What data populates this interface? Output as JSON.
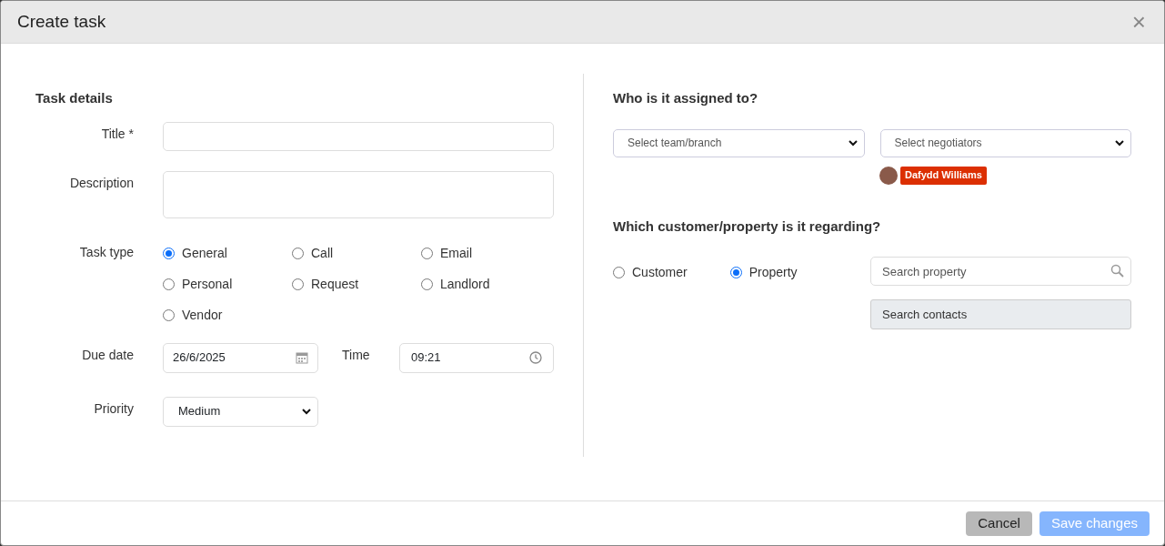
{
  "dialog": {
    "title": "Create task",
    "close": "×"
  },
  "task_details": {
    "heading": "Task details",
    "title_field": {
      "label": "Title *"
    },
    "description_field": {
      "label": "Description"
    },
    "task_type": {
      "label": "Task type",
      "options": [
        {
          "label": "General",
          "selected": true
        },
        {
          "label": "Call",
          "selected": false
        },
        {
          "label": "Email",
          "selected": false
        },
        {
          "label": "Personal",
          "selected": false
        },
        {
          "label": "Request",
          "selected": false
        },
        {
          "label": "Landlord",
          "selected": false
        },
        {
          "label": "Vendor",
          "selected": false
        }
      ]
    },
    "due_date": {
      "label": "Due date",
      "value": "26/6/2025"
    },
    "time": {
      "label": "Time",
      "value": "09:21"
    },
    "priority": {
      "label": "Priority",
      "value": "Medium"
    }
  },
  "assignment": {
    "heading": "Who is it assigned to?",
    "team_select": "Select team/branch",
    "negotiator_select": "Select negotiators",
    "negotiators": [
      {
        "name": "Dafydd Williams",
        "color": "#dc2f02"
      }
    ]
  },
  "regarding": {
    "heading": "Which customer/property is it regarding?",
    "options": [
      {
        "label": "Customer",
        "selected": false
      },
      {
        "label": "Property",
        "selected": true
      }
    ],
    "search": {
      "placeholder": "Search property"
    },
    "contacts_button": "Search contacts"
  },
  "footer": {
    "buttons": [
      {
        "label": "Cancel",
        "kind": "secondary",
        "disabled": false
      },
      {
        "label": "Save changes",
        "kind": "primary",
        "disabled": true
      }
    ]
  }
}
